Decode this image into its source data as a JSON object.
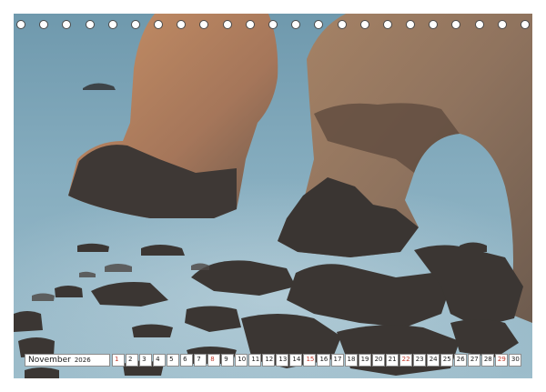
{
  "calendar": {
    "month": "November",
    "year": "2026",
    "days": [
      {
        "n": "1",
        "sun": true
      },
      {
        "n": "2",
        "sun": false
      },
      {
        "n": "3",
        "sun": false
      },
      {
        "n": "4",
        "sun": false
      },
      {
        "n": "5",
        "sun": false
      },
      {
        "n": "6",
        "sun": false
      },
      {
        "n": "7",
        "sun": false
      },
      {
        "n": "8",
        "sun": true
      },
      {
        "n": "9",
        "sun": false
      },
      {
        "n": "10",
        "sun": false
      },
      {
        "n": "11",
        "sun": false
      },
      {
        "n": "12",
        "sun": false
      },
      {
        "n": "13",
        "sun": false
      },
      {
        "n": "14",
        "sun": false
      },
      {
        "n": "15",
        "sun": true
      },
      {
        "n": "16",
        "sun": false
      },
      {
        "n": "17",
        "sun": false
      },
      {
        "n": "18",
        "sun": false
      },
      {
        "n": "19",
        "sun": false
      },
      {
        "n": "20",
        "sun": false
      },
      {
        "n": "21",
        "sun": false
      },
      {
        "n": "22",
        "sun": true
      },
      {
        "n": "23",
        "sun": false
      },
      {
        "n": "24",
        "sun": false
      },
      {
        "n": "25",
        "sun": false
      },
      {
        "n": "26",
        "sun": false
      },
      {
        "n": "27",
        "sun": false
      },
      {
        "n": "28",
        "sun": false
      },
      {
        "n": "29",
        "sun": true
      },
      {
        "n": "30",
        "sun": false
      }
    ]
  },
  "colors": {
    "sea": "#7aa3b6",
    "rock_light": "#b88a63",
    "rock_dark": "#3a3633",
    "sunday": "#c0392b"
  },
  "binding": {
    "ring_count": 23
  }
}
